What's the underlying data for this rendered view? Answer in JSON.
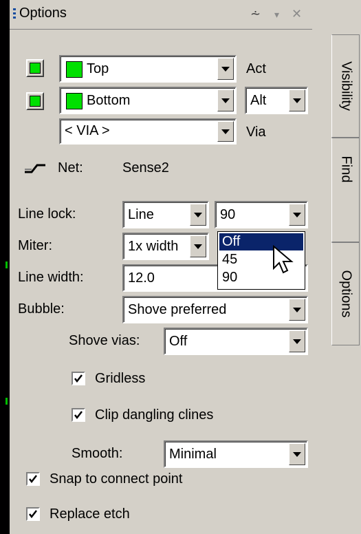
{
  "title": {
    "text": "Options",
    "pin_icon": "pin-icon",
    "arrow_icon": "dropdown-arrow-icon",
    "close_icon": "close-icon"
  },
  "layers": {
    "top": {
      "value": "Top",
      "label": "Act"
    },
    "bottom": {
      "value": "Bottom",
      "alt_value": "Alt"
    },
    "via": {
      "value": "< VIA >",
      "label": "Via"
    }
  },
  "net": {
    "label": "Net:",
    "value": "Sense2",
    "icon": "net-icon"
  },
  "line_lock": {
    "label": "Line lock:",
    "mode": "Line",
    "angle": "90"
  },
  "miter": {
    "label": "Miter:",
    "value": "1x width"
  },
  "line_width": {
    "label": "Line width:",
    "value": "12.0"
  },
  "angle_dropdown": {
    "options": [
      "Off",
      "45",
      "90"
    ],
    "selected": "Off"
  },
  "bubble": {
    "label": "Bubble:",
    "value": "Shove preferred"
  },
  "shove_vias": {
    "label": "Shove vias:",
    "value": "Off"
  },
  "gridless": {
    "label": "Gridless",
    "checked": true
  },
  "clip_dangling": {
    "label": "Clip dangling clines",
    "checked": true
  },
  "smooth": {
    "label": "Smooth:",
    "value": "Minimal"
  },
  "snap": {
    "label": "Snap to connect point",
    "checked": true
  },
  "replace_etch": {
    "label": "Replace etch",
    "checked": true
  },
  "tabs": [
    "Visibility",
    "Find",
    "Options"
  ],
  "colors": {
    "layer_green": "#00e000",
    "selection": "#0a246a",
    "panel": "#d4d0c8"
  }
}
